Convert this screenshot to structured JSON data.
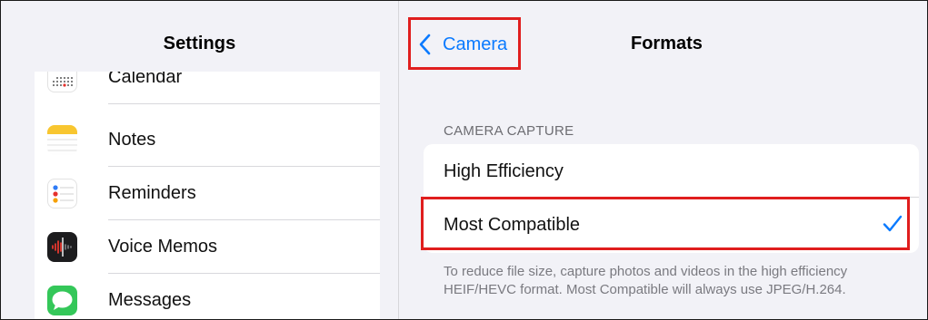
{
  "sidebar": {
    "title": "Settings",
    "items": [
      {
        "label": "Calendar",
        "icon": "calendar-icon"
      },
      {
        "label": "Notes",
        "icon": "notes-icon"
      },
      {
        "label": "Reminders",
        "icon": "reminders-icon"
      },
      {
        "label": "Voice Memos",
        "icon": "voice-memos-icon"
      },
      {
        "label": "Messages",
        "icon": "messages-icon"
      }
    ]
  },
  "detail": {
    "back_label": "Camera",
    "title": "Formats",
    "section_header": "CAMERA CAPTURE",
    "options": [
      {
        "label": "High Efficiency",
        "selected": false
      },
      {
        "label": "Most Compatible",
        "selected": true
      }
    ],
    "footer": "To reduce file size, capture photos and videos in the high efficiency HEIF/HEVC format. Most Compatible will always use JPEG/H.264."
  },
  "colors": {
    "accent": "#0a7aff",
    "highlight": "#e01e1e",
    "background": "#f2f2f7"
  }
}
